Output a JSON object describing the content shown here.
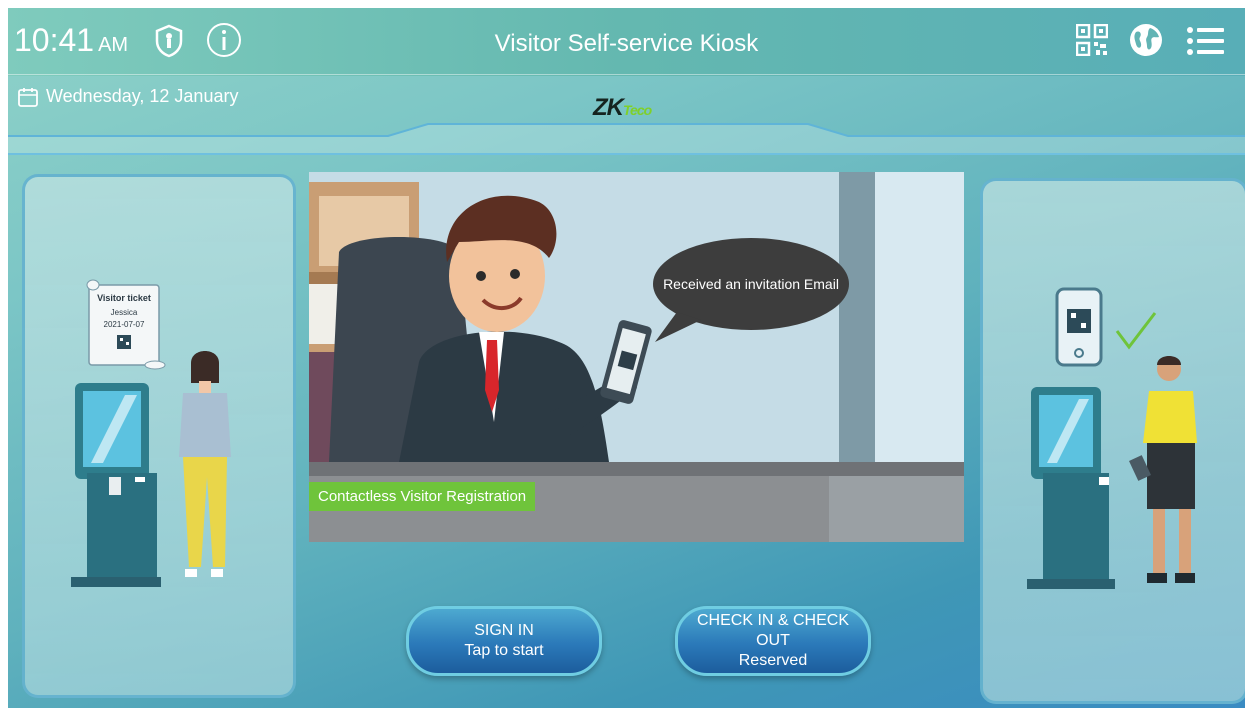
{
  "header": {
    "time": "10:41",
    "ampm": "AM",
    "title": "Visitor Self-service Kiosk",
    "date": "Wednesday, 12 January",
    "icons": [
      "shield-icon",
      "info-icon",
      "qr-code-icon",
      "globe-icon",
      "menu-icon"
    ]
  },
  "logo": {
    "main": "ZK",
    "suffix": "Teco"
  },
  "left_panel": {
    "ticket": {
      "title": "Visitor ticket",
      "name": "Jessica",
      "date": "2021-07-07"
    }
  },
  "video": {
    "bubble": "Received an invitation Email",
    "caption": "Contactless Visitor Registration"
  },
  "buttons": {
    "signin": {
      "label": "SIGN IN",
      "sub": "Tap to start"
    },
    "check": {
      "label": "CHECK IN & CHECK OUT",
      "sub": "Reserved"
    }
  },
  "colors": {
    "accent_green": "#6fc43b",
    "button_blue": "#2b79b9",
    "panel_border": "#5fafcd"
  }
}
